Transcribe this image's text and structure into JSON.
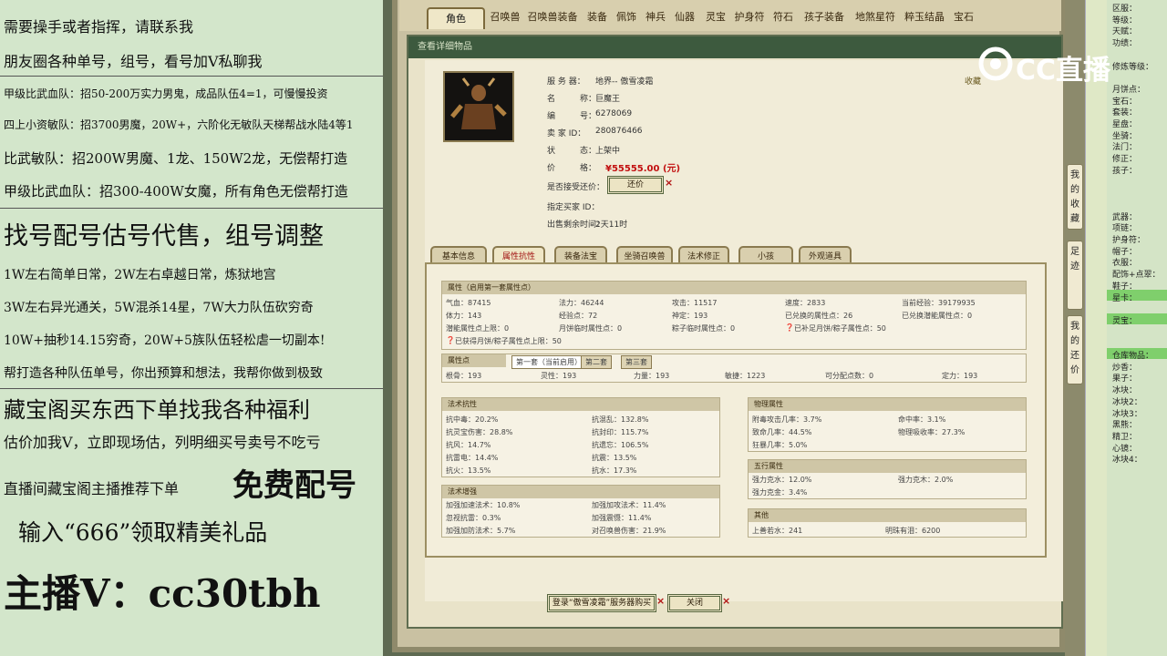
{
  "left_ad": {
    "lines": [
      "需要操手或者指挥，请联系我",
      "朋友圈各种单号，组号，看号加V私聊我",
      "甲级比武血队：招50-200万实力男鬼，成品队伍4=1，可慢慢投资",
      "四上小资敏队：招3700男魔，20W+，六阶化无敏队天梯帮战水陆4等1",
      "比武敏队：招200W男魔、1龙、150W2龙，无偿帮打造",
      "甲级比武血队：招300-400W女魔，所有角色无偿帮打造",
      "找号配号估号代售，组号调整",
      "1W左右简单日常，2W左右卓越日常，炼狱地宫",
      "3W左右异光通关，5W混杀14星，7W大力队伍砍穷奇",
      "10W+抽秒14.15穷奇，20W+5族队伍轻松虐一切副本!",
      "帮打造各种队伍单号，你出预算和想法，我帮你做到极致",
      "藏宝阁买东西下单找我各种福利",
      "估价加我V，立即现场估，列明细买号卖号不吃亏",
      "直播间藏宝阁主播推荐下单",
      "免费配号",
      "输入“666”领取精美礼品",
      "主播V：cc30tbh"
    ]
  },
  "top_tabs": [
    "角色",
    "召唤兽",
    "召唤兽装备",
    "装备",
    "佩饰",
    "神兵",
    "仙器",
    "灵宝",
    "护身符",
    "符石",
    "孩子装备",
    "地煞星符",
    "粹玉结晶",
    "宝石"
  ],
  "dialog": {
    "title": "查看详细物品",
    "server_label": "服 务 器：",
    "server": "地界-- 傲雪凌霜",
    "name_label": "名　　　称：",
    "name": "巨魔王",
    "id_label": "编　　　号：",
    "id": "6278069",
    "seller_label": "卖 家 ID：",
    "seller": "280876466",
    "status_label": "状　　　态：",
    "status": "上架中",
    "price_label": "价　　　格：",
    "price": "¥55555.00 (元)",
    "bargain_label": "是否接受还价：",
    "bargain_btn": "还价",
    "buyer_label": "指定买家 ID：",
    "time_label": "出售剩余时间：",
    "time": "2天11时",
    "fav": "收藏"
  },
  "sub_tabs": [
    "基本信息",
    "属性抗性",
    "装备法宝",
    "坐骑召唤兽",
    "法术修正",
    "小孩",
    "外观道具"
  ],
  "attr": {
    "head": "属性（启用第一套属性点）",
    "rows": [
      [
        "气血：87415",
        "法力：46244",
        "攻击：11517",
        "速度：2833",
        "当前经验：39179935"
      ],
      [
        "体力：143",
        "经验点：72",
        "神定：193",
        "已兑换的属性点：26",
        "已兑换潜能属性点：0"
      ],
      [
        "潜能属性点上限：0",
        "月饼临时属性点：0",
        "粽子临时属性点：0",
        "已补足月饼/粽子属性点：50",
        ""
      ]
    ],
    "row4": "已获得月饼/粽子属性点上限：50"
  },
  "points": {
    "head": "属性点",
    "tabs": [
      "第一套（当前启用）",
      "第二套",
      "第三套"
    ],
    "row": [
      "根骨：193",
      "灵性：193",
      "力量：193",
      "敏捷：1223",
      "可分配点数：0",
      "定力：193"
    ]
  },
  "resist": {
    "head": "法术抗性",
    "cells": [
      "抗中毒：20.2%",
      "抗混乱：132.8%",
      "抗灵宝伤害：28.8%",
      "抗封印：115.7%",
      "抗风：14.7%",
      "抗遗忘：106.5%",
      "抗雷电：14.4%",
      "抗震：13.5%",
      "抗火：13.5%",
      "抗水：17.3%"
    ]
  },
  "boost": {
    "head": "法术增强",
    "cells": [
      "加强加速法术：10.8%",
      "加强加攻法术：11.4%",
      "忽视抗雷：0.3%",
      "加强震慑：11.4%",
      "加强加防法术：5.7%",
      "对召唤兽伤害：21.9%"
    ]
  },
  "phys": {
    "head": "物理属性",
    "cells": [
      "附毒攻击几率：3.7%",
      "命中率：3.1%",
      "致命几率：44.5%",
      "物理吸收率：27.3%",
      "狂暴几率：5.0%",
      ""
    ]
  },
  "wuxing": {
    "head": "五行属性",
    "cells": [
      "强力克水：12.0%",
      "强力克木：2.0%",
      "强力克金：3.4%",
      ""
    ]
  },
  "other": {
    "head": "其他",
    "cells": [
      "上善若水：241",
      "明珠有泪：6200"
    ]
  },
  "buttons": {
    "login": "登录“傲雪凌霜”服务器购买",
    "close": "关闭"
  },
  "side_tabs": [
    "我的收藏",
    "足迹",
    "我的还价"
  ],
  "right_labels": [
    "区服：",
    "等级：",
    "天赋：",
    "功绩：",
    "",
    "修炼等级：",
    "",
    "月饼点：",
    "宝石：",
    "套装：",
    "星盘：",
    "坐骑：",
    "法门：",
    "修正：",
    "孩子：",
    "",
    "",
    "",
    "武器：",
    "项链：",
    "护身符：",
    "帽子：",
    "衣服：",
    "配饰+点翠：",
    "鞋子：",
    "星卡：",
    "",
    "灵宝：",
    "",
    "",
    "仓库物品：",
    "炒香：",
    "果子：",
    "冰块：",
    "冰块2：",
    "冰块3：",
    "黑熊：",
    "精卫：",
    "心镜：",
    "冰块4："
  ],
  "logo_text": "CC直播"
}
